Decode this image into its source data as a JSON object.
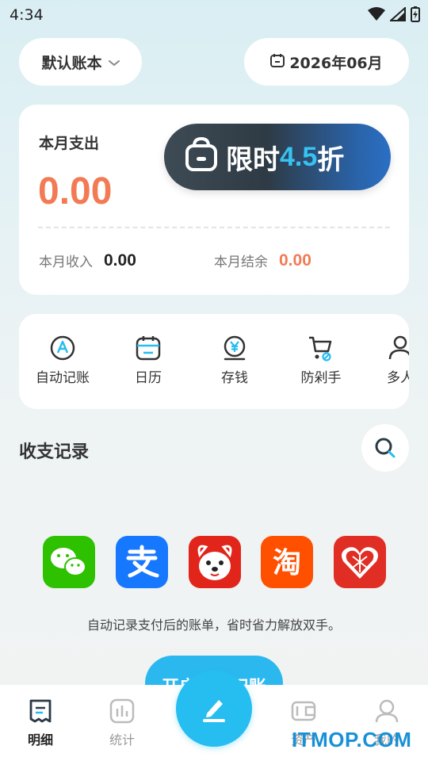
{
  "status_bar": {
    "time": "4:34"
  },
  "header": {
    "ledger_label": "默认账本",
    "date_label": "2026年06月"
  },
  "summary": {
    "expense_label": "本月支出",
    "expense_amount": "0.00",
    "income_label": "本月收入",
    "income_amount": "0.00",
    "balance_label": "本月结余",
    "balance_amount": "0.00"
  },
  "promo": {
    "prefix": "限时",
    "discount": "4.5",
    "suffix": "折"
  },
  "features": [
    {
      "label": "自动记账",
      "icon": "auto-ledger-icon"
    },
    {
      "label": "日历",
      "icon": "calendar-icon"
    },
    {
      "label": "存钱",
      "icon": "yen-coin-icon"
    },
    {
      "label": "防剁手",
      "icon": "shopping-cart-block-icon"
    },
    {
      "label": "多人",
      "icon": "person-icon"
    }
  ],
  "records": {
    "title": "收支记录",
    "tagline": "自动记录支付后的账单，省时省力解放双手。",
    "enable_button": "开启自动记账"
  },
  "apps": [
    {
      "name": "wechat",
      "color": "#2dc100"
    },
    {
      "name": "alipay",
      "color": "#1677ff"
    },
    {
      "name": "jd",
      "color": "#e1251b"
    },
    {
      "name": "taobao",
      "color": "#ff5000"
    },
    {
      "name": "pinduoduo",
      "color": "#e02e24"
    }
  ],
  "tabs": [
    {
      "label": "明细",
      "icon": "receipt-icon",
      "active": true
    },
    {
      "label": "统计",
      "icon": "bar-chart-icon",
      "active": false
    },
    {
      "label": "资产",
      "icon": "wallet-icon",
      "active": false
    },
    {
      "label": "我的",
      "icon": "profile-icon",
      "active": false
    }
  ],
  "watermark": "ITMOP.COM",
  "colors": {
    "accent": "#26bdf0",
    "expense": "#f27a55",
    "promo_highlight": "#37c2f2"
  }
}
